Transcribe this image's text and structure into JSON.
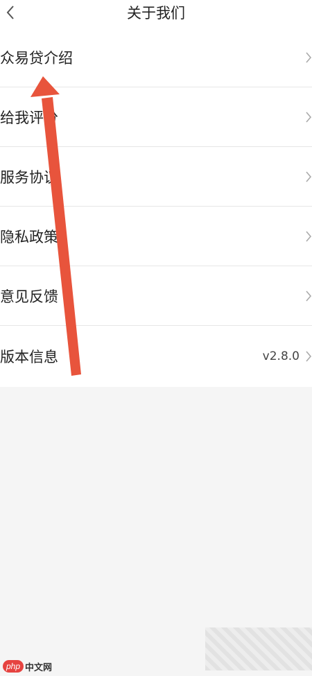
{
  "header": {
    "title": "关于我们"
  },
  "menu": {
    "items": [
      {
        "label": "众易贷介绍",
        "value": ""
      },
      {
        "label": "给我评分",
        "value": ""
      },
      {
        "label": "服务协议",
        "value": ""
      },
      {
        "label": "隐私政策",
        "value": ""
      },
      {
        "label": "意见反馈",
        "value": ""
      },
      {
        "label": "版本信息",
        "value": "v2.8.0"
      }
    ]
  },
  "watermark": {
    "logo_text": "php",
    "site_name": "中文网"
  },
  "colors": {
    "annotation_arrow": "#e8543c",
    "background": "#f5f5f5",
    "row_background": "#ffffff",
    "divider": "#e6e6e6"
  },
  "icons": {
    "back": "chevron-left-icon",
    "row_chevron": "chevron-right-icon"
  }
}
